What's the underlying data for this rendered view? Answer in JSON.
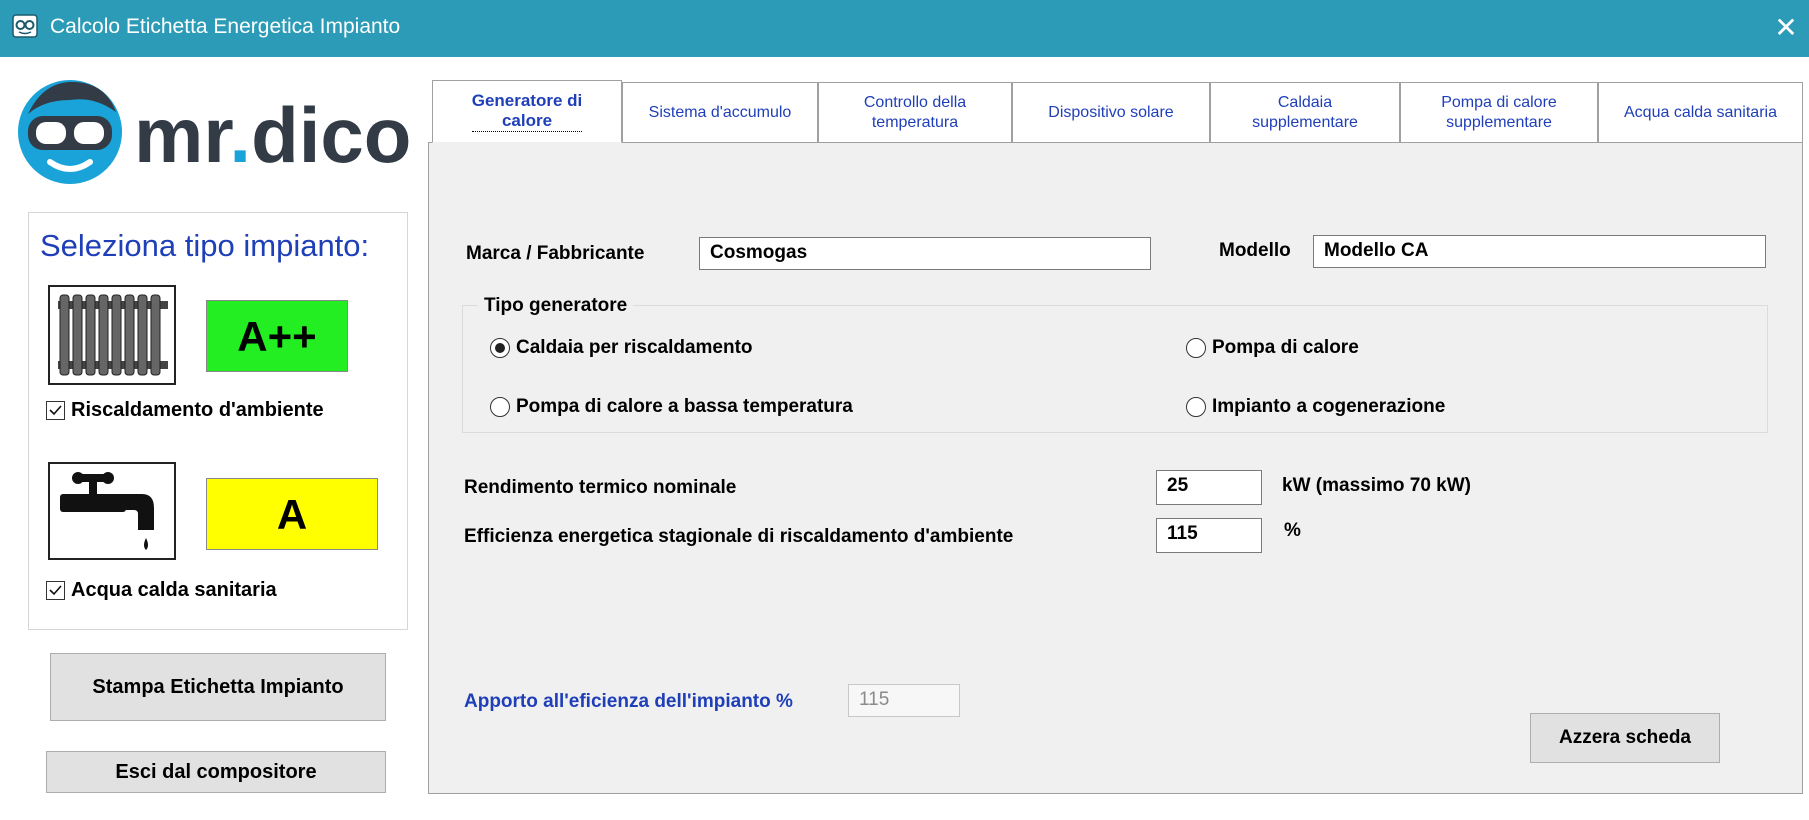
{
  "window": {
    "title": "Calcolo Etichetta Energetica Impianto",
    "close_glyph": "✕"
  },
  "logo": {
    "text_main": "mr",
    "text_dot": ".",
    "text_end": "dico"
  },
  "left": {
    "heading": "Seleziona tipo impianto:",
    "heating": {
      "icon": "radiator-icon",
      "rating": "A++",
      "rating_color": "#22ee22",
      "checkbox_label": "Riscaldamento d'ambiente",
      "checked": true
    },
    "water": {
      "icon": "tap-icon",
      "rating": "A",
      "rating_color": "#ffff00",
      "checkbox_label": "Acqua calda sanitaria",
      "checked": true
    },
    "print_button": "Stampa Etichetta Impianto",
    "exit_button": "Esci dal compositore"
  },
  "tabs": [
    {
      "label": "Generatore di\ncalore",
      "active": true
    },
    {
      "label": "Sistema d'accumulo",
      "active": false
    },
    {
      "label": "Controllo della\ntemperatura",
      "active": false
    },
    {
      "label": "Dispositivo solare",
      "active": false
    },
    {
      "label": "Caldaia\nsupplementare",
      "active": false
    },
    {
      "label": "Pompa di calore\nsupplementare",
      "active": false
    },
    {
      "label": "Acqua calda sanitaria",
      "active": false
    }
  ],
  "form": {
    "marca_label": "Marca / Fabbricante",
    "marca_value": "Cosmogas",
    "modello_label": "Modello",
    "modello_value": "Modello CA",
    "tipo_title": "Tipo generatore",
    "radios": {
      "caldaia": "Caldaia per riscaldamento",
      "pompa_bt": "Pompa di calore a bassa temperatura",
      "pompa": "Pompa di calore",
      "cogen": "Impianto a cogenerazione",
      "selected": "caldaia"
    },
    "rendimento_label": "Rendimento termico nominale",
    "rendimento_value": "25",
    "rendimento_unit": "kW (massimo 70 kW)",
    "efficienza_label": "Efficienza energetica stagionale di riscaldamento d'ambiente",
    "efficienza_value": "115",
    "efficienza_unit": "%",
    "apporto_label": "Apporto all'eficienza dell'impianto %",
    "apporto_value": "115",
    "reset_button": "Azzera scheda"
  }
}
